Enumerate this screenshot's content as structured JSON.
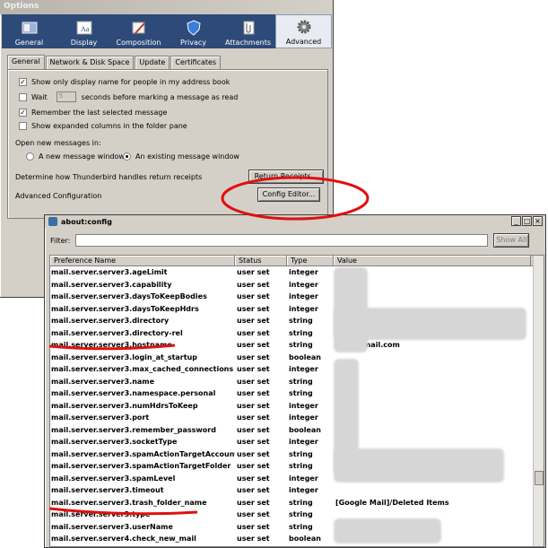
{
  "options": {
    "title": "Options",
    "toolbar": [
      {
        "label": "General",
        "icon": "general-icon"
      },
      {
        "label": "Display",
        "icon": "display-icon"
      },
      {
        "label": "Composition",
        "icon": "composition-icon"
      },
      {
        "label": "Privacy",
        "icon": "privacy-icon"
      },
      {
        "label": "Attachments",
        "icon": "attachments-icon"
      },
      {
        "label": "Advanced",
        "icon": "advanced-icon",
        "active": true
      }
    ],
    "tabs": [
      "General",
      "Network & Disk Space",
      "Update",
      "Certificates"
    ],
    "settings": {
      "show_display_name": "Show only display name for people in my address book",
      "wait_label": "Wait",
      "wait_value": "5",
      "wait_suffix": "seconds before marking a message as read",
      "remember_last": "Remember the last selected message",
      "expanded_columns": "Show expanded columns in the folder pane",
      "open_new_messages": "Open new messages in:",
      "new_window": "A new message window",
      "existing_window": "An existing message window",
      "receipts_label": "Determine how Thunderbird handles return receipts",
      "receipts_button": "Return Receipts...",
      "advanced_label": "Advanced Configuration",
      "config_button": "Config Editor..."
    }
  },
  "config": {
    "title": "about:config",
    "filter_label": "Filter:",
    "show_all": "Show All",
    "columns": [
      "Preference Name",
      "Status",
      "Type",
      "Value"
    ],
    "rows": [
      {
        "name": "mail.server.server3.ageLimit",
        "status": "user set",
        "type": "integer",
        "value": ""
      },
      {
        "name": "mail.server.server3.capability",
        "status": "user set",
        "type": "integer",
        "value": ""
      },
      {
        "name": "mail.server.server3.daysToKeepBodies",
        "status": "user set",
        "type": "integer",
        "value": ""
      },
      {
        "name": "mail.server.server3.daysToKeepHdrs",
        "status": "user set",
        "type": "integer",
        "value": ""
      },
      {
        "name": "mail.server.server3.directory",
        "status": "user set",
        "type": "string",
        "value": ""
      },
      {
        "name": "mail.server.server3.directory-rel",
        "status": "user set",
        "type": "string",
        "value": ""
      },
      {
        "name": "mail.server.server3.hostname",
        "status": "user set",
        "type": "string",
        "value": "imap.gmail.com"
      },
      {
        "name": "mail.server.server3.login_at_startup",
        "status": "user set",
        "type": "boolean",
        "value": ""
      },
      {
        "name": "mail.server.server3.max_cached_connections",
        "status": "user set",
        "type": "integer",
        "value": ""
      },
      {
        "name": "mail.server.server3.name",
        "status": "user set",
        "type": "string",
        "value": ""
      },
      {
        "name": "mail.server.server3.namespace.personal",
        "status": "user set",
        "type": "string",
        "value": ""
      },
      {
        "name": "mail.server.server3.numHdrsToKeep",
        "status": "user set",
        "type": "integer",
        "value": ""
      },
      {
        "name": "mail.server.server3.port",
        "status": "user set",
        "type": "integer",
        "value": ""
      },
      {
        "name": "mail.server.server3.remember_password",
        "status": "user set",
        "type": "boolean",
        "value": ""
      },
      {
        "name": "mail.server.server3.socketType",
        "status": "user set",
        "type": "integer",
        "value": ""
      },
      {
        "name": "mail.server.server3.spamActionTargetAccount",
        "status": "user set",
        "type": "string",
        "value": ""
      },
      {
        "name": "mail.server.server3.spamActionTargetFolder",
        "status": "user set",
        "type": "string",
        "value": ""
      },
      {
        "name": "mail.server.server3.spamLevel",
        "status": "user set",
        "type": "integer",
        "value": ""
      },
      {
        "name": "mail.server.server3.timeout",
        "status": "user set",
        "type": "integer",
        "value": ""
      },
      {
        "name": "mail.server.server3.trash_folder_name",
        "status": "user set",
        "type": "string",
        "value": "[Google Mail]/Deleted Items"
      },
      {
        "name": "mail.server.server3.type",
        "status": "user set",
        "type": "string",
        "value": ""
      },
      {
        "name": "mail.server.server3.userName",
        "status": "user set",
        "type": "string",
        "value": ""
      },
      {
        "name": "mail.server.server4.check_new_mail",
        "status": "user set",
        "type": "boolean",
        "value": ""
      }
    ]
  },
  "colors": {
    "annotation": "#e01010",
    "toolbar": "#2d4a78"
  }
}
